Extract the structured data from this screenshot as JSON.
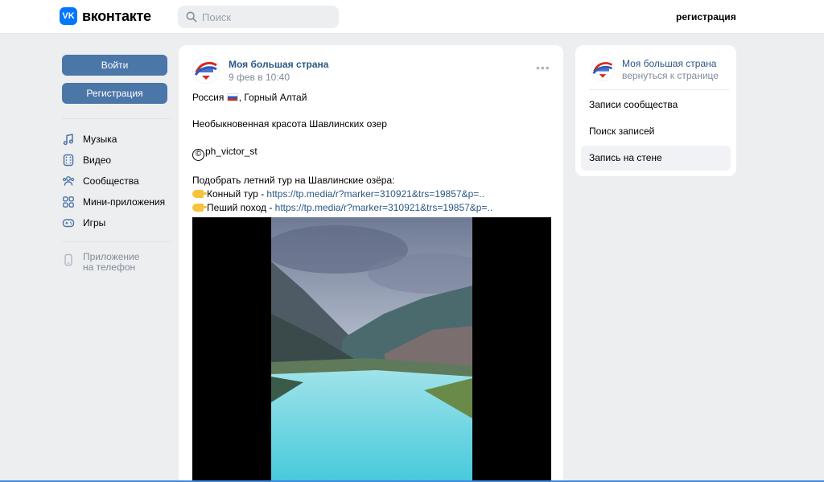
{
  "header": {
    "logo_mark": "VK",
    "logo_text": "вконтакте",
    "search_placeholder": "Поиск",
    "register_link": "регистрация"
  },
  "left_nav": {
    "login_button": "Войти",
    "register_button": "Регистрация",
    "items": [
      {
        "label": "Музыка",
        "icon": "music-icon"
      },
      {
        "label": "Видео",
        "icon": "video-icon"
      },
      {
        "label": "Сообщества",
        "icon": "communities-icon"
      },
      {
        "label": "Мини-приложения",
        "icon": "mini-apps-icon"
      },
      {
        "label": "Игры",
        "icon": "gamepad-icon"
      }
    ],
    "app_line1": "Приложение",
    "app_line2": "на телефон"
  },
  "post": {
    "author": "Моя большая страна",
    "date": "9 фев в 10:40",
    "more": "•••",
    "line1": "Россия , Горный Алтай",
    "line2": "Необыкновенная красота Шавлинских озер",
    "line3": "ph_victor_st",
    "copyright": "©",
    "line4": "Подобрать летний тур на Шавлинские озёра:",
    "tour1_label": "Конный тур - ",
    "tour1_link": "https://tp.media/r?marker=310921&trs=19857&p=..",
    "tour2_label": "Пеший поход - ",
    "tour2_link": "https://tp.media/r?marker=310921&trs=19857&p=.."
  },
  "right_card": {
    "title": "Моя большая страна",
    "subtitle": "вернуться к странице",
    "items": [
      {
        "label": "Записи сообщества",
        "active": false
      },
      {
        "label": "Поиск записей",
        "active": false
      },
      {
        "label": "Запись на стене",
        "active": true
      }
    ]
  },
  "colors": {
    "accent": "#4b76a8",
    "link": "#2a5885",
    "brand": "#0077ff",
    "secondary_text": "#818c99",
    "background": "#edeef0"
  }
}
